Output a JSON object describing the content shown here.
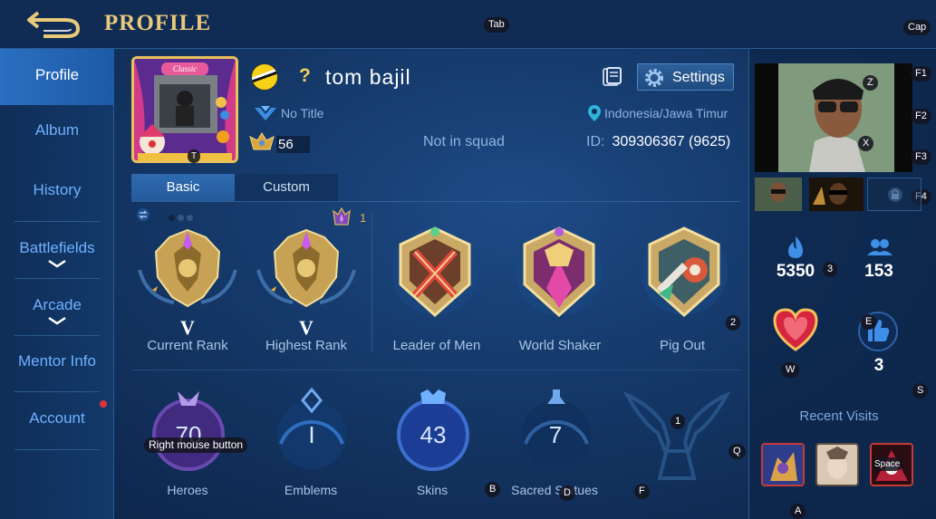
{
  "header": {
    "title": "PROFILE"
  },
  "key_hints": {
    "tab": "Tab",
    "cap": "Cap",
    "f1": "F1",
    "f2": "F2",
    "f3": "F3",
    "f4": "F4",
    "z": "Z",
    "x": "X",
    "three": "3",
    "two": "2",
    "one": "1",
    "e": "E",
    "w": "W",
    "s": "S",
    "q": "Q",
    "b": "B",
    "d": "D",
    "f": "F",
    "a": "A",
    "t": "T",
    "right_mouse": "Right mouse button",
    "space": "Space"
  },
  "sidebar": {
    "items": [
      {
        "label": "Profile",
        "active": true
      },
      {
        "label": "Album"
      },
      {
        "label": "History"
      },
      {
        "label": "Battlefields"
      },
      {
        "label": "Arcade"
      },
      {
        "label": "Mentor Info"
      },
      {
        "label": "Account",
        "has_notification": true
      }
    ]
  },
  "player": {
    "frame_banner": "Classic",
    "question_mark": "?",
    "name": "tom bajil",
    "title": "No Title",
    "level": "56",
    "squad": "Not in squad",
    "location": "Indonesia/Jawa Timur",
    "id_label": "ID:",
    "id_value": "309306367 (9625)"
  },
  "buttons": {
    "settings": "Settings"
  },
  "tabs": [
    {
      "label": "Basic",
      "active": true
    },
    {
      "label": "Custom"
    }
  ],
  "ranks": {
    "star_count": "1",
    "current": {
      "label": "Current Rank",
      "tier": "V"
    },
    "highest": {
      "label": "Highest Rank",
      "tier": "V"
    }
  },
  "achievements": [
    {
      "label": "Leader of Men"
    },
    {
      "label": "World Shaker"
    },
    {
      "label": "Pig Out"
    }
  ],
  "stats": [
    {
      "label": "Heroes",
      "value": "70"
    },
    {
      "label": "Emblems",
      "value": "I"
    },
    {
      "label": "Skins",
      "value": "43"
    },
    {
      "label": "Sacred Statues",
      "value": "7"
    }
  ],
  "right_panel": {
    "popularity": "5350",
    "followers": "153",
    "likes": "3",
    "recent_visits_title": "Recent Visits"
  },
  "colors": {
    "gold": "#e9c97a",
    "accent_blue": "#6fb0ff",
    "notification_red": "#e0343c"
  }
}
